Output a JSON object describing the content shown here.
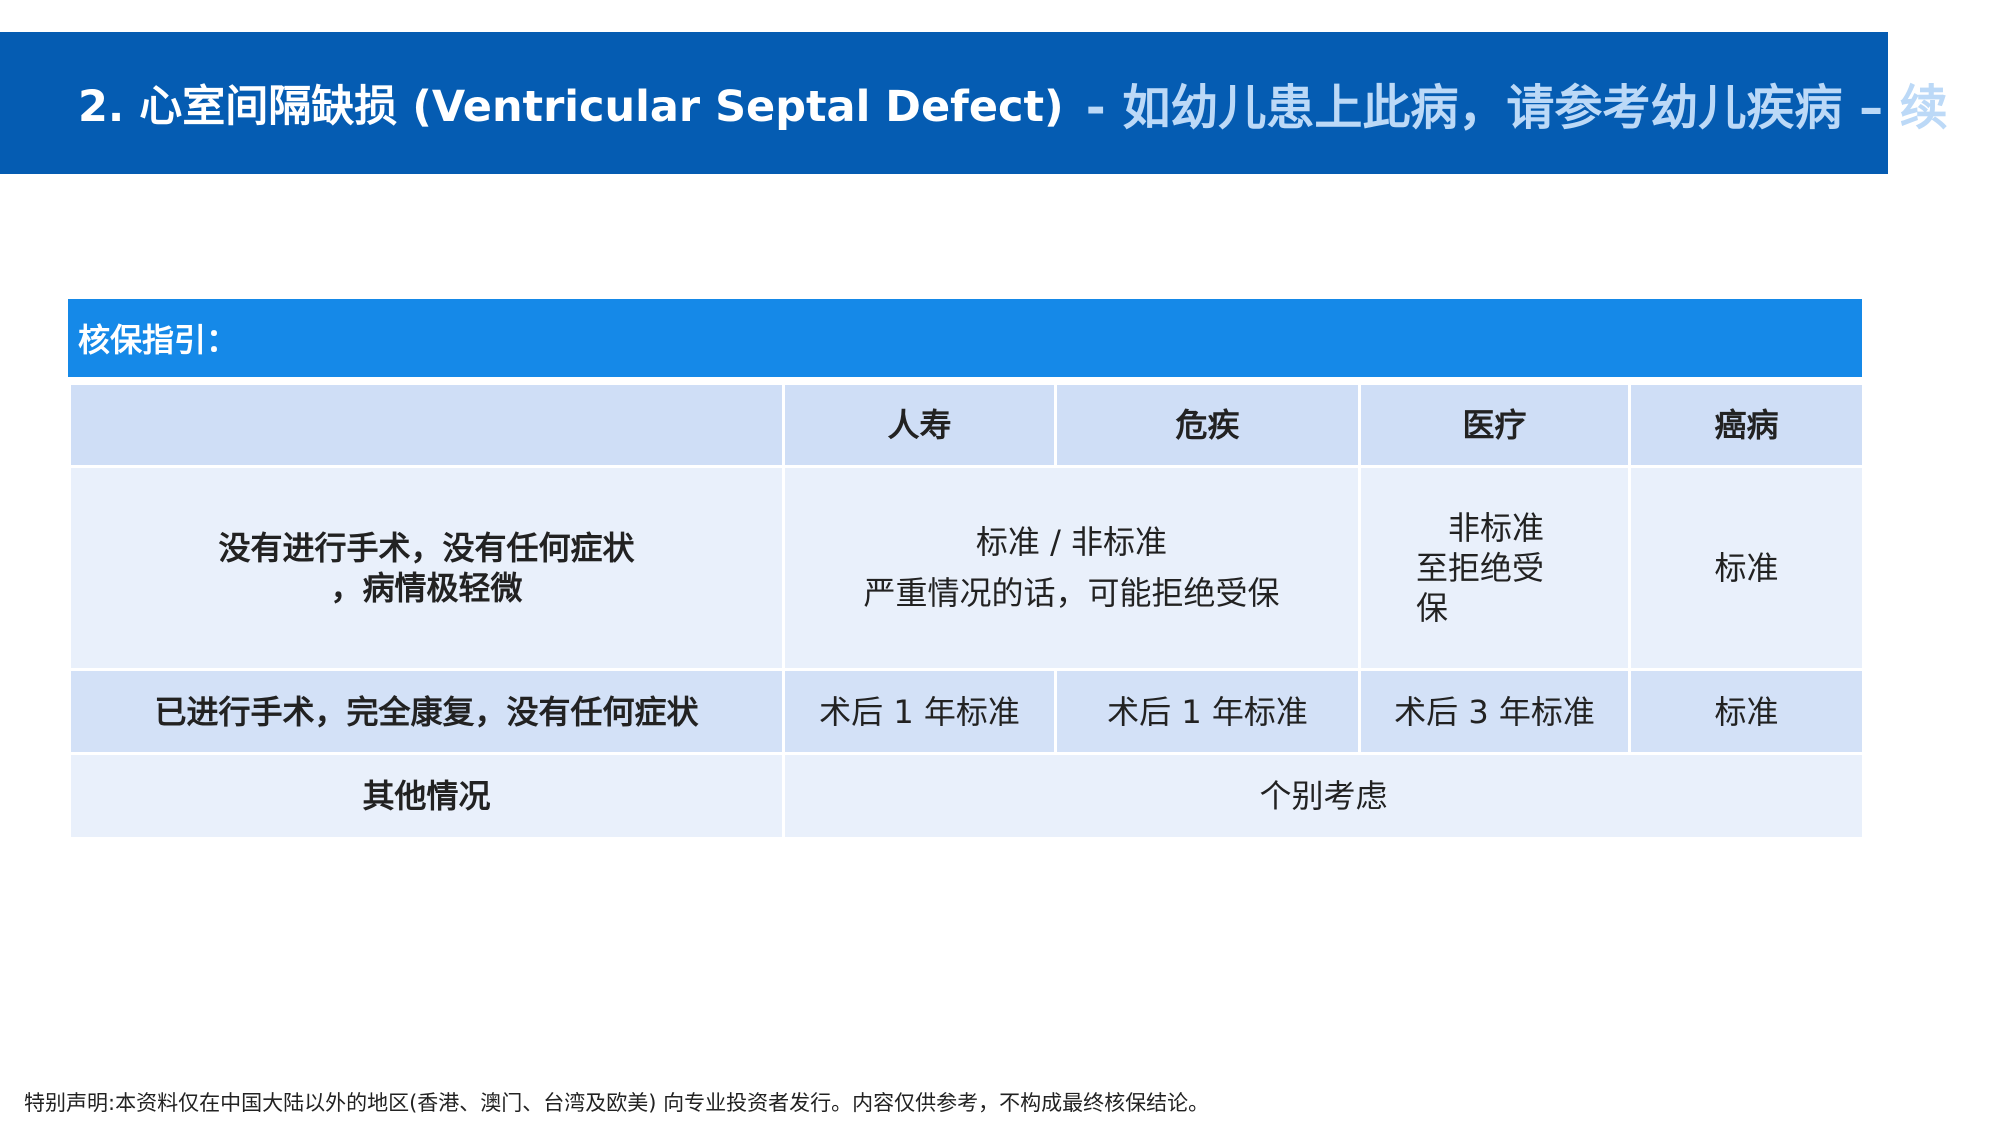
{
  "title": {
    "main": "2. 心室间隔缺损 (Ventricular Septal Defect)",
    "sub": "- 如幼儿患上此病，请参考幼儿疾病 – 续"
  },
  "guide_label": "核保指引：",
  "table": {
    "columns": [
      "",
      "人寿",
      "危疾",
      "医疗",
      "癌病"
    ],
    "rows": [
      {
        "label_lines": [
          "没有进行手术，没有任何症状",
          "，病情极轻微"
        ],
        "life_ci_lines": [
          "标准 / 非标准",
          "严重情况的话，可能拒绝受保"
        ],
        "medical_lines": [
          "非标准",
          "至拒绝受",
          "保"
        ],
        "cancer": "标准"
      },
      {
        "label": "已进行手术，完全康复，没有任何症状",
        "life": "术后 1 年标准",
        "ci": "术后 1 年标准",
        "medical": "术后 3 年标准",
        "cancer": "标准"
      },
      {
        "label": "其他情况",
        "all": "个别考虑"
      }
    ]
  },
  "disclaimer": "特别声明:本资料仅在中国大陆以外的地区(香港、澳门、台湾及欧美) 向专业投资者发行。内容仅供参考，不构成最终核保结论。"
}
